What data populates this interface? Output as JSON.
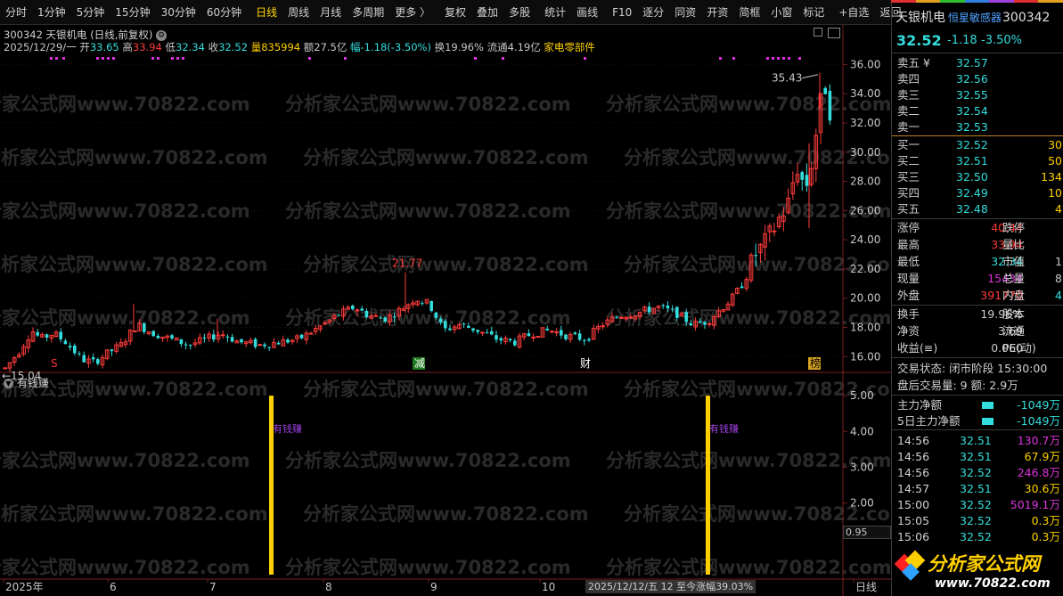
{
  "toolbar": {
    "items": [
      "分时",
      "1分钟",
      "5分钟",
      "15分钟",
      "30分钟",
      "60分钟",
      "日线",
      "周线",
      "月线",
      "多周期",
      "更多 〉",
      "复权",
      "叠加",
      "多股",
      "统计",
      "画线",
      "F10",
      "逐分",
      "同资",
      "开资",
      "简框",
      "小窗",
      "标记",
      "+自选",
      "返回"
    ],
    "active_index": 6
  },
  "header": {
    "title": "300342 天银机电 (日线,前复权)",
    "date": "2025/12/29/一",
    "open_label": "开",
    "open": "33.65",
    "high_label": "高",
    "high": "33.94",
    "low_label": "低",
    "low": "32.34",
    "close_label": "收",
    "close": "32.52",
    "vol_label": "量",
    "vol": "835994",
    "amount_label": "额",
    "amount": "27.5亿",
    "chg_label": "幅",
    "chg": "-1.18(-3.50%)",
    "turnover_label": "换",
    "turnover": "19.96%",
    "float_label": "流通",
    "float": "4.19亿",
    "sector": "家电零部件"
  },
  "watermark": "分析家公式网www.70822.com",
  "price_chart": {
    "y_ticks": [
      "36.00",
      "34.00",
      "32.00",
      "30.00",
      "28.00",
      "26.00",
      "24.00",
      "22.00",
      "20.00",
      "18.00",
      "16.00"
    ],
    "y_range": [
      14.8,
      37.0
    ],
    "labels": {
      "max": "21.77",
      "recent_high": "35.43",
      "min": "15.04"
    },
    "markers": [
      {
        "text": "S",
        "color": "#ff3030",
        "type": "plain"
      },
      {
        "text": "减",
        "color": "#ffffff",
        "bg": "#1e7a1e",
        "type": "box"
      },
      {
        "text": "财",
        "color": "#ffffff",
        "type": "plain"
      },
      {
        "text": "榜",
        "color": "#000000",
        "bg": "#d4a020",
        "type": "box"
      }
    ]
  },
  "indicator": {
    "name": "有钱赚",
    "y_ticks": [
      "5.00",
      "4.00",
      "3.00",
      "2.00"
    ],
    "current": "0.95",
    "bar_label": "有钱赚"
  },
  "x_axis": {
    "labels": [
      "2025年",
      "6",
      "7",
      "8",
      "9",
      "10",
      "11",
      "日线"
    ],
    "info": "2025/12/12/五 12 至今涨幅39.03%"
  },
  "quote_panel": {
    "name": "天银机电",
    "tag": "恒星敏感器",
    "code": "300342",
    "price": "32.52",
    "change": "-1.18",
    "change_pct": "-3.50%",
    "asks": [
      {
        "label": "卖五 ¥",
        "price": "32.57",
        "vol": ""
      },
      {
        "label": "卖四",
        "price": "32.56",
        "vol": ""
      },
      {
        "label": "卖三",
        "price": "32.55",
        "vol": ""
      },
      {
        "label": "卖二",
        "price": "32.54",
        "vol": ""
      },
      {
        "label": "卖一",
        "price": "32.53",
        "vol": ""
      }
    ],
    "bids": [
      {
        "label": "买一",
        "price": "32.52",
        "vol": "30"
      },
      {
        "label": "买二",
        "price": "32.51",
        "vol": "50"
      },
      {
        "label": "买三",
        "price": "32.50",
        "vol": "134"
      },
      {
        "label": "买四",
        "price": "32.49",
        "vol": "10"
      },
      {
        "label": "买五",
        "price": "32.48",
        "vol": "4"
      }
    ],
    "stats": [
      {
        "l1": "涨停",
        "v1": "40.44",
        "c1": "#ff3b3b",
        "l2": "跌停",
        "v2": "",
        "c2": "#c8c8c8"
      },
      {
        "l1": "最高",
        "v1": "33.94",
        "c1": "#ff3b3b",
        "l2": "量比",
        "v2": "",
        "c2": "#c8c8c8"
      },
      {
        "l1": "最低",
        "v1": "32.34",
        "c1": "#33dddd",
        "l2": "市值",
        "v2": "1",
        "c2": "#c8c8c8"
      },
      {
        "l1": "现量",
        "v1": "15434",
        "c1": "#dd33dd",
        "l2": "总量",
        "v2": "8",
        "c2": "#c8c8c8"
      },
      {
        "l1": "外盘",
        "v1": "391770",
        "c1": "#ff3b3b",
        "l2": "内盘",
        "v2": "4",
        "c2": "#33dddd"
      }
    ],
    "stats2": [
      {
        "l1": "换手",
        "v1": "19.96%",
        "l2": "股本",
        "v2": ""
      },
      {
        "l1": "净资",
        "v1": "3.69",
        "l2": "流通",
        "v2": ""
      },
      {
        "l1": "收益(≡)",
        "v1": "0.060",
        "l2": "PE(动)",
        "v2": ""
      }
    ],
    "trade_status": "交易状态: 闭市阶段 15:30:00",
    "after_hours": "盘后交易量: 9  额: 2.9万",
    "main_flow": [
      {
        "label": "主力净额",
        "value": "-1049万"
      },
      {
        "label": "5日主力净额",
        "value": "-1049万"
      }
    ],
    "ticks": [
      {
        "time": "14:56",
        "price": "32.51",
        "vol": "130.7万",
        "color": "#dd33dd"
      },
      {
        "time": "14:56",
        "price": "32.51",
        "vol": "67.9万",
        "color": "#ffd000"
      },
      {
        "time": "14:56",
        "price": "32.52",
        "vol": "246.8万",
        "color": "#dd33dd"
      },
      {
        "time": "14:57",
        "price": "32.51",
        "vol": "30.6万",
        "color": "#ffd000"
      },
      {
        "time": "15:00",
        "price": "32.52",
        "vol": "5019.1万",
        "color": "#dd33dd"
      },
      {
        "time": "15:05",
        "price": "32.52",
        "vol": "0.3万",
        "color": "#ffd000"
      },
      {
        "time": "15:06",
        "price": "32.52",
        "vol": "0.3万",
        "color": "#ffd000"
      }
    ],
    "logo_text": "分析家公式网",
    "logo_url": "www.70822.com"
  },
  "colors": {
    "up": "#ff3b3b",
    "down": "#33dddd",
    "bar": "#ffd000",
    "grid": "#3a2020"
  }
}
